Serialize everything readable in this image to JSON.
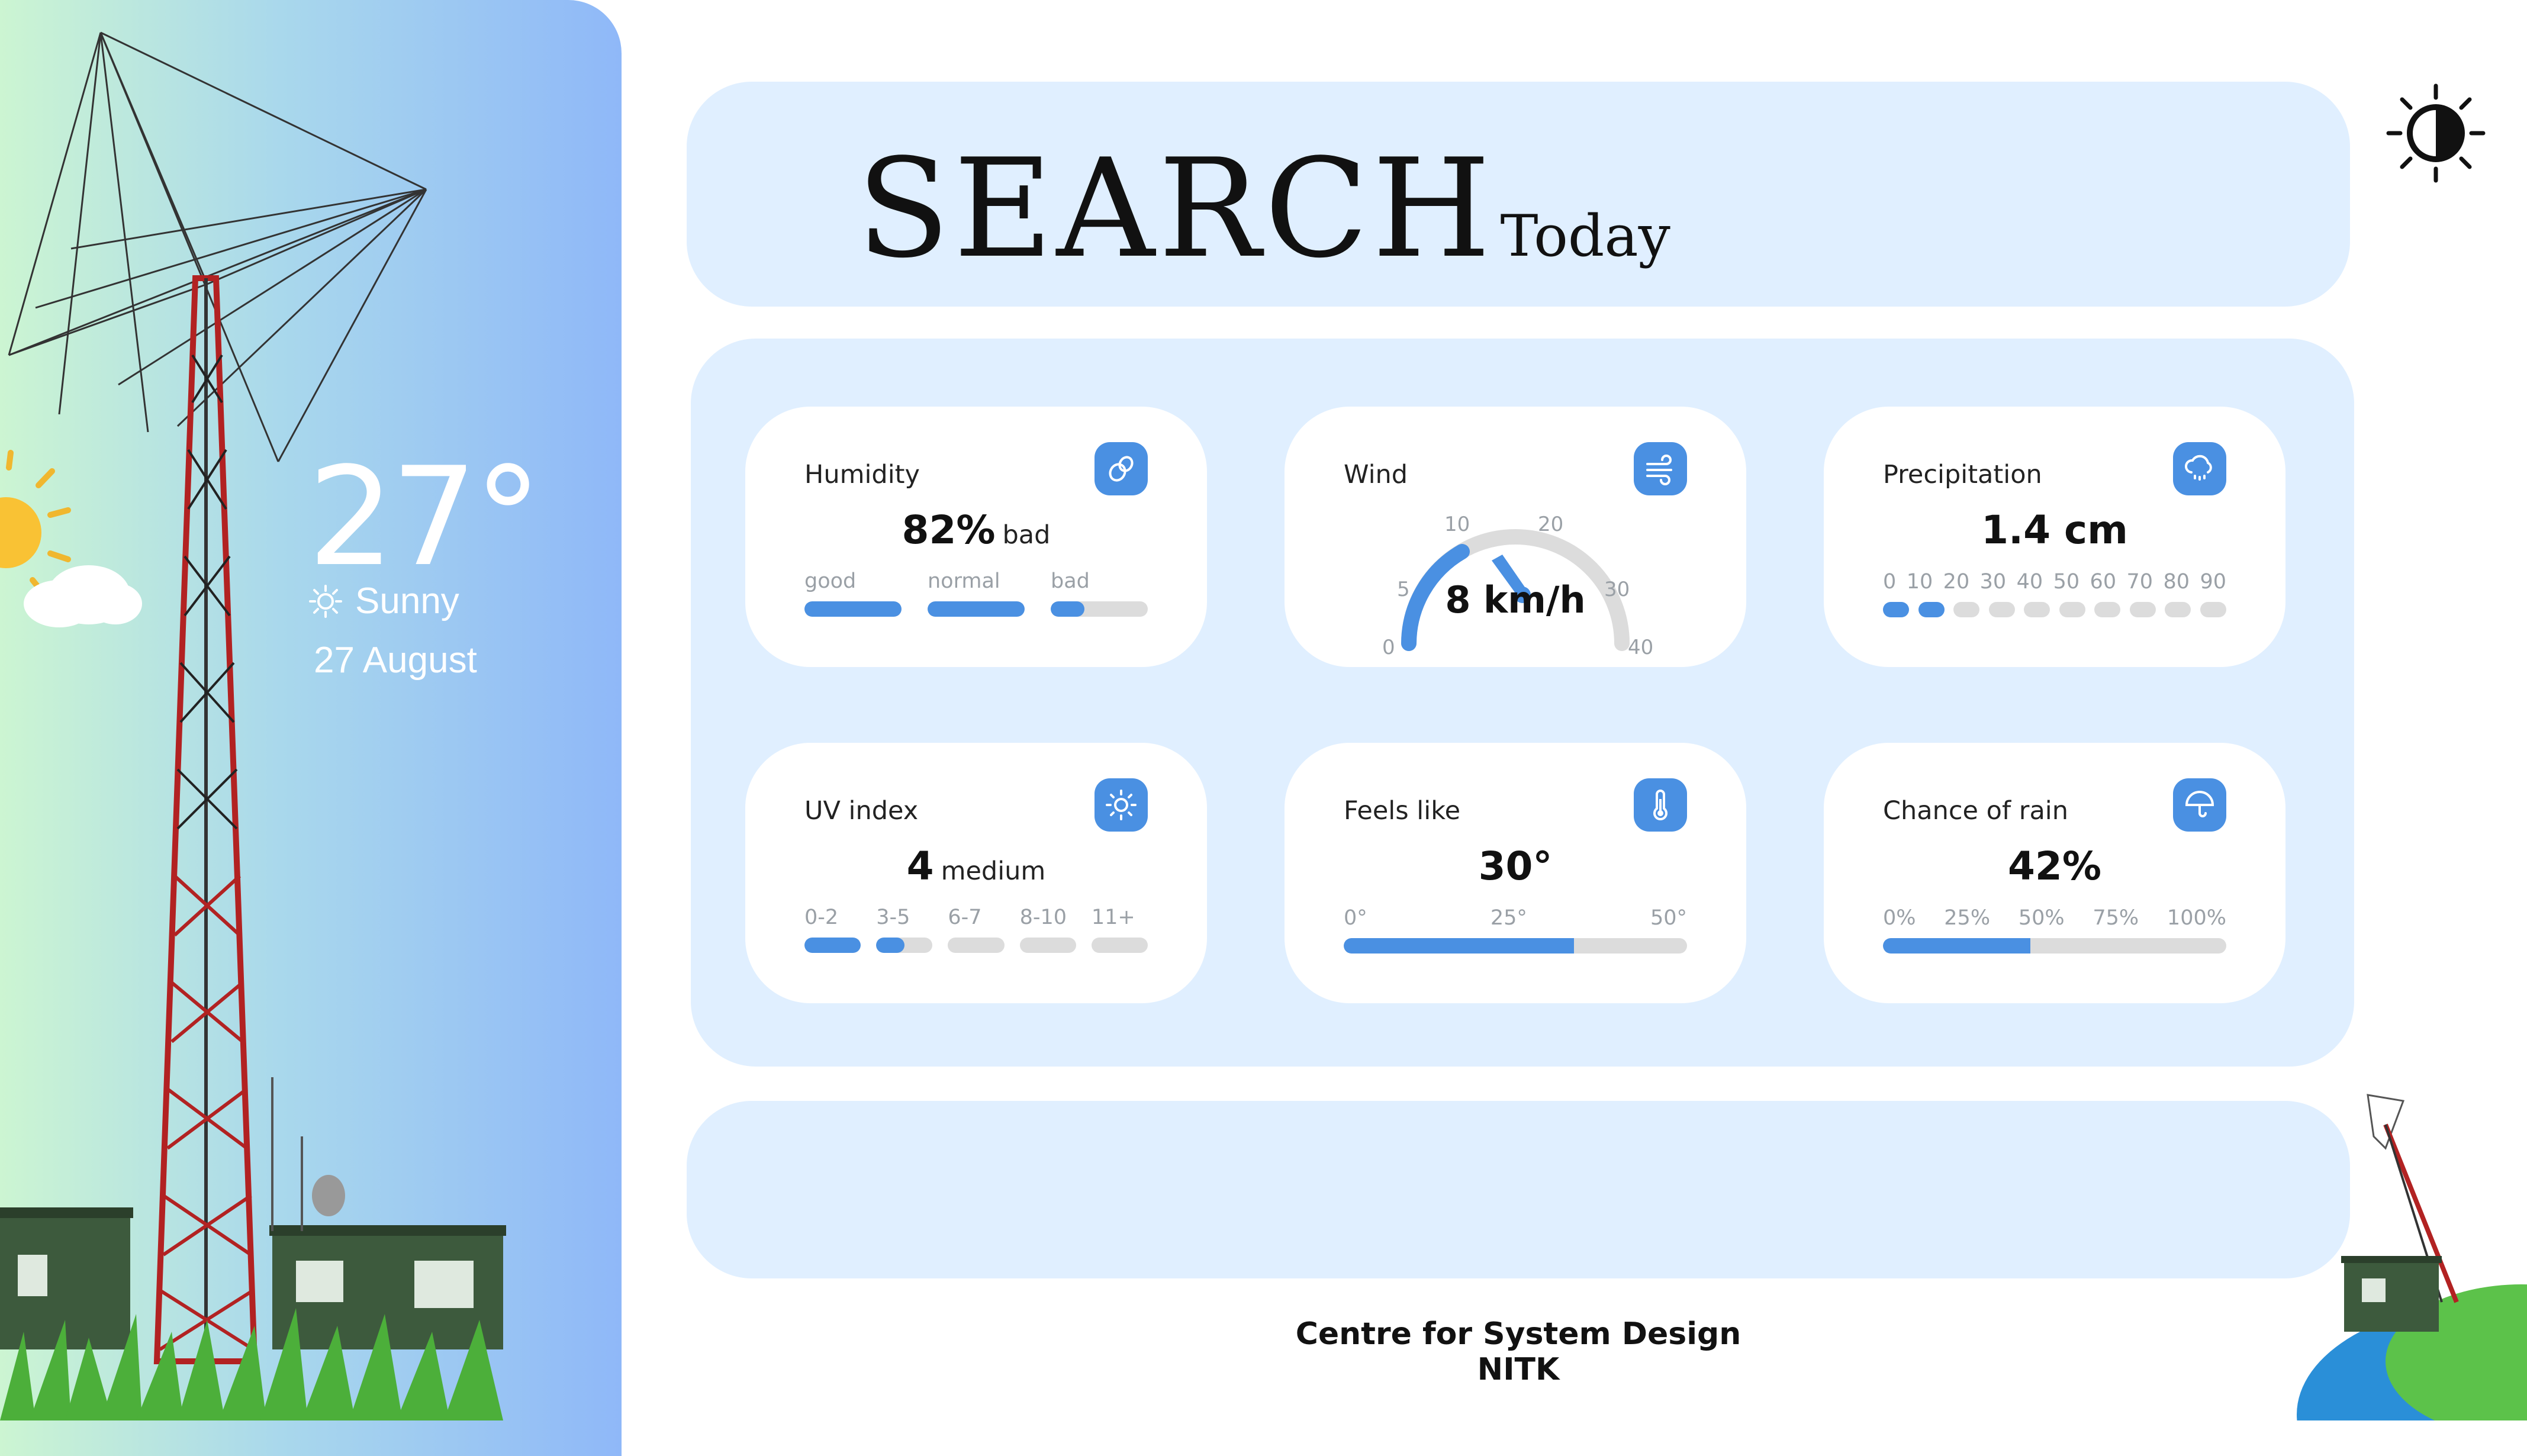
{
  "weather": {
    "temperature": "27°",
    "condition": "Sunny",
    "date": "27 August"
  },
  "header": {
    "title": "SEARCH",
    "subtitle": "Today"
  },
  "cards": {
    "humidity": {
      "label": "Humidity",
      "value": "82%",
      "unit": "bad",
      "segments": [
        {
          "label": "good",
          "fill": 1.0
        },
        {
          "label": "normal",
          "fill": 1.0
        },
        {
          "label": "bad",
          "fill": 0.35
        }
      ]
    },
    "wind": {
      "label": "Wind",
      "value": "8 km/h",
      "gauge_ticks": [
        "0",
        "5",
        "10",
        "20",
        "30",
        "40"
      ],
      "speed_kmh": 8
    },
    "precipitation": {
      "label": "Precipitation",
      "value": "1.4 cm",
      "ticks": [
        "0",
        "10",
        "20",
        "30",
        "40",
        "50",
        "60",
        "70",
        "80",
        "90"
      ],
      "active_dots": 2
    },
    "uv": {
      "label": "UV index",
      "value": "4",
      "unit": "medium",
      "segments": [
        {
          "label": "0-2",
          "fill": 1.0
        },
        {
          "label": "3-5",
          "fill": 0.5
        },
        {
          "label": "6-7",
          "fill": 0
        },
        {
          "label": "8-10",
          "fill": 0
        },
        {
          "label": "11+",
          "fill": 0
        }
      ]
    },
    "feels_like": {
      "label": "Feels like",
      "value": "30°",
      "ticks": [
        "0°",
        "25°",
        "50°"
      ],
      "fill": 0.67
    },
    "chance_of_rain": {
      "label": "Chance of rain",
      "value": "42%",
      "ticks": [
        "0%",
        "25%",
        "50%",
        "75%",
        "100%"
      ],
      "fill": 0.43
    }
  },
  "footer": {
    "line1": "Centre for System Design",
    "line2": "NITK"
  },
  "colors": {
    "accent": "#4a90e2",
    "panel": "#e0efff",
    "track": "#dcdcdc"
  },
  "icons": {
    "theme_toggle": "contrast-sun-icon",
    "humidity": "droplets-icon",
    "wind": "wind-icon",
    "precipitation": "cloud-rain-icon",
    "uv": "sun-icon",
    "feels_like": "thermometer-icon",
    "rain": "umbrella-icon"
  }
}
